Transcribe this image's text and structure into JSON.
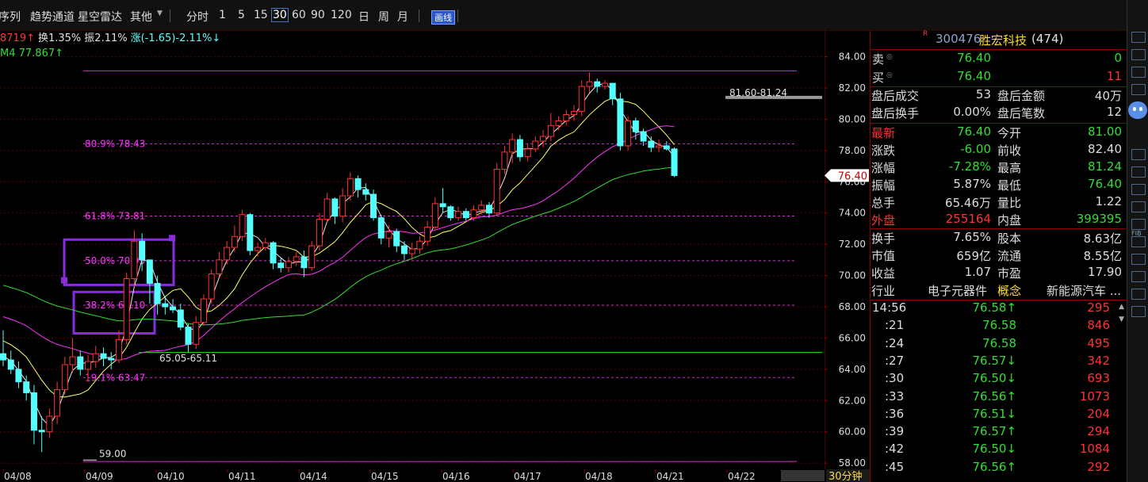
{
  "toolbar": {
    "items": [
      "序列",
      "趋势通道",
      "星空雷达",
      "其他"
    ],
    "periods": [
      "分时",
      "1",
      "5",
      "15",
      "30",
      "60",
      "90",
      "120",
      "日",
      "周",
      "月"
    ],
    "selected_period": "30",
    "draw_btn": "画线"
  },
  "info": {
    "line1_prefix": "8719↑",
    "line1_turnover": "换1.35%",
    "line1_amp": "振2.11%",
    "line1_change": "涨(-1.65)-2.11%↓",
    "line2": "M4 77.867↑"
  },
  "chart_data": {
    "type": "candlestick",
    "period": "30分钟",
    "ylim": [
      57.5,
      85.5
    ],
    "y_ticks": [
      58,
      60,
      62,
      64,
      66,
      68,
      70,
      72,
      74,
      76,
      78,
      80,
      82,
      84
    ],
    "y_tick_labels": [
      "58.00",
      "60.00",
      "62.00",
      "64.00",
      "66.00",
      "68.00",
      "70.00",
      "72.00",
      "74.00",
      "76.00",
      "78.00",
      "80.00",
      "82.00",
      "84.00"
    ],
    "x_labels": [
      "04/08",
      "04/09",
      "04/10",
      "04/11",
      "04/14",
      "04/15",
      "04/16",
      "04/17",
      "04/18",
      "04/21",
      "04/22"
    ],
    "candles_ohlc": [
      [
        65.0,
        66.5,
        64.2,
        64.6
      ],
      [
        64.6,
        65.2,
        63.7,
        64.0
      ],
      [
        64.0,
        64.5,
        62.8,
        63.2
      ],
      [
        63.2,
        63.6,
        62.0,
        62.5
      ],
      [
        62.5,
        63.0,
        59.2,
        60.1
      ],
      [
        60.1,
        61.0,
        58.7,
        60.0
      ],
      [
        60.0,
        61.5,
        59.6,
        61.0
      ],
      [
        61.0,
        63.2,
        60.5,
        62.7
      ],
      [
        62.7,
        64.8,
        62.4,
        64.3
      ],
      [
        64.3,
        66.0,
        63.8,
        64.8
      ],
      [
        64.8,
        65.2,
        63.6,
        64.0
      ],
      [
        64.0,
        64.9,
        63.2,
        64.5
      ],
      [
        64.5,
        65.5,
        64.1,
        65.0
      ],
      [
        65.0,
        65.4,
        64.2,
        64.7
      ],
      [
        64.7,
        65.1,
        64.0,
        64.6
      ],
      [
        64.6,
        66.5,
        64.4,
        65.9
      ],
      [
        65.9,
        70.2,
        65.6,
        69.8
      ],
      [
        69.8,
        72.9,
        69.3,
        72.2
      ],
      [
        72.2,
        72.7,
        70.3,
        71.0
      ],
      [
        71.0,
        70.5,
        68.2,
        69.5
      ],
      [
        69.5,
        70.0,
        67.5,
        68.2
      ],
      [
        68.2,
        68.7,
        67.5,
        68.0
      ],
      [
        68.0,
        68.5,
        67.6,
        67.8
      ],
      [
        67.8,
        68.2,
        66.5,
        66.7
      ],
      [
        66.7,
        66.9,
        65.1,
        65.6
      ],
      [
        65.6,
        67.4,
        65.3,
        67.0
      ],
      [
        67.0,
        68.8,
        66.8,
        68.5
      ],
      [
        68.5,
        70.4,
        68.2,
        70.1
      ],
      [
        70.1,
        71.5,
        69.9,
        71.0
      ],
      [
        71.0,
        72.2,
        70.7,
        71.8
      ],
      [
        71.8,
        73.2,
        71.5,
        72.5
      ],
      [
        72.5,
        74.2,
        72.2,
        73.9
      ],
      [
        73.9,
        74.0,
        71.3,
        71.6
      ],
      [
        71.6,
        72.1,
        71.2,
        71.8
      ],
      [
        71.8,
        72.4,
        71.6,
        72.1
      ],
      [
        72.1,
        72.2,
        70.4,
        70.8
      ],
      [
        70.8,
        71.1,
        70.2,
        70.5
      ],
      [
        70.5,
        71.2,
        70.2,
        70.9
      ],
      [
        70.9,
        71.5,
        70.6,
        71.2
      ],
      [
        71.2,
        71.6,
        69.9,
        70.5
      ],
      [
        70.5,
        72.2,
        70.3,
        71.9
      ],
      [
        71.9,
        74.0,
        71.6,
        73.6
      ],
      [
        73.6,
        75.3,
        73.4,
        74.9
      ],
      [
        74.9,
        75.0,
        73.3,
        73.8
      ],
      [
        73.8,
        75.6,
        73.4,
        75.1
      ],
      [
        75.1,
        76.6,
        74.8,
        76.2
      ],
      [
        76.2,
        76.4,
        75.0,
        75.5
      ],
      [
        75.5,
        75.9,
        74.8,
        75.2
      ],
      [
        75.2,
        75.5,
        73.5,
        73.7
      ],
      [
        73.7,
        73.9,
        72.0,
        72.4
      ],
      [
        72.4,
        73.2,
        71.8,
        72.8
      ],
      [
        72.8,
        73.0,
        71.5,
        71.9
      ],
      [
        71.9,
        72.2,
        71.0,
        71.4
      ],
      [
        71.4,
        72.1,
        71.0,
        71.7
      ],
      [
        71.7,
        72.5,
        71.4,
        72.2
      ],
      [
        72.2,
        73.5,
        71.9,
        73.1
      ],
      [
        73.1,
        75.0,
        72.9,
        74.6
      ],
      [
        74.6,
        75.6,
        74.0,
        74.4
      ],
      [
        74.4,
        74.5,
        73.5,
        73.7
      ],
      [
        73.7,
        74.4,
        73.5,
        74.1
      ],
      [
        74.1,
        74.3,
        73.5,
        73.7
      ],
      [
        73.7,
        74.5,
        73.5,
        74.2
      ],
      [
        74.2,
        74.8,
        73.9,
        74.5
      ],
      [
        74.5,
        74.7,
        73.7,
        74.0
      ],
      [
        74.0,
        77.2,
        73.8,
        76.8
      ],
      [
        76.8,
        78.3,
        76.5,
        77.9
      ],
      [
        77.9,
        79.1,
        77.2,
        78.7
      ],
      [
        78.7,
        79.0,
        77.3,
        77.6
      ],
      [
        77.6,
        78.4,
        77.3,
        78.1
      ],
      [
        78.1,
        78.9,
        77.9,
        78.6
      ],
      [
        78.6,
        79.3,
        78.2,
        78.9
      ],
      [
        78.9,
        80.4,
        78.6,
        79.6
      ],
      [
        79.6,
        80.2,
        79.3,
        79.9
      ],
      [
        79.9,
        80.6,
        79.6,
        80.3
      ],
      [
        80.3,
        80.9,
        79.9,
        80.5
      ],
      [
        80.5,
        82.5,
        80.2,
        82.1
      ],
      [
        82.1,
        83.0,
        81.7,
        82.4
      ],
      [
        82.4,
        82.6,
        81.7,
        82.1
      ],
      [
        82.1,
        82.5,
        81.9,
        82.3
      ],
      [
        82.3,
        81.6,
        80.9,
        81.3
      ],
      [
        81.3,
        81.7,
        78.0,
        78.3
      ],
      [
        78.3,
        80.2,
        78.0,
        79.9
      ],
      [
        79.9,
        80.1,
        78.7,
        79.2
      ],
      [
        79.2,
        79.4,
        78.3,
        78.6
      ],
      [
        78.6,
        78.9,
        77.9,
        78.2
      ],
      [
        78.2,
        78.7,
        77.9,
        78.3
      ],
      [
        78.3,
        78.6,
        78.0,
        78.1
      ],
      [
        78.1,
        78.2,
        76.3,
        76.4
      ]
    ],
    "series": [
      {
        "name": "M1",
        "color": "#e8e8e8"
      },
      {
        "name": "M2",
        "color": "#ffff66"
      },
      {
        "name": "M3",
        "color": "#ff33ff"
      },
      {
        "name": "M4",
        "color": "#33dd33"
      }
    ],
    "fib_labels": [
      {
        "text": "80.9% 78.43",
        "price": 78.43
      },
      {
        "text": "61.8% 73.81",
        "price": 73.81
      },
      {
        "text": "50.0% 70.95",
        "price": 70.95
      },
      {
        "text": "38.2% 68.10",
        "price": 68.1
      },
      {
        "text": "19.1% 63.47",
        "price": 63.47
      }
    ],
    "range_labels": [
      {
        "text": "81.60-81.24",
        "price": 81.5
      },
      {
        "text": "65.05-65.11",
        "price": 65.1
      },
      {
        "text": "59.00",
        "price": 59.0
      }
    ],
    "current_price_label": "76.40",
    "period_label": "30分钟"
  },
  "panel": {
    "stock_code": "300476",
    "stock_name": "胜宏科技",
    "stock_rank": "(474)",
    "r_mark": "R",
    "sell_label": "卖",
    "sell_price": "76.40",
    "sell_vol": "0",
    "buy_label": "买",
    "buy_price": "76.40",
    "buy_vol": "11",
    "stats": [
      {
        "l1": "盘后成交",
        "v1": "53",
        "l2": "盘后金额",
        "v2": "40万"
      },
      {
        "l1": "盘后换手",
        "v1": "0.00%",
        "l2": "盘后笔数",
        "v2": "12"
      },
      {
        "l1": "最新",
        "v1": "76.40",
        "l2": "今开",
        "v2": "81.00"
      },
      {
        "l1": "涨跌",
        "v1": "-6.00",
        "l2": "前收",
        "v2": "82.40"
      },
      {
        "l1": "涨幅",
        "v1": "-7.28%",
        "l2": "最高",
        "v2": "81.24"
      },
      {
        "l1": "振幅",
        "v1": "5.87%",
        "l2": "最低",
        "v2": "76.40"
      },
      {
        "l1": "总手",
        "v1": "65.46万",
        "l2": "量比",
        "v2": "1.22"
      },
      {
        "l1": "外盘",
        "v1": "255164",
        "l2": "内盘",
        "v2": "399395"
      },
      {
        "l1": "换手",
        "v1": "7.65%",
        "l2": "股本",
        "v2": "8.63亿"
      },
      {
        "l1": "市值",
        "v1": "659亿",
        "l2": "流通",
        "v2": "8.55亿"
      },
      {
        "l1": "收益",
        "v1": "1.07",
        "l2": "市盈",
        "v2": "17.90"
      }
    ],
    "industry_label": "行业",
    "industry_value": "电子元器件",
    "concept_label": "概念",
    "concept_value": "新能源汽车 ...",
    "ticks": [
      {
        "time": "14:56",
        "price": "76.58↑",
        "vol": "295"
      },
      {
        "time": ":21",
        "price": "76.58",
        "vol": "846"
      },
      {
        "time": ":24",
        "price": "76.58",
        "vol": "495"
      },
      {
        "time": ":27",
        "price": "76.57↓",
        "vol": "342"
      },
      {
        "time": ":30",
        "price": "76.50↓",
        "vol": "693"
      },
      {
        "time": ":33",
        "price": "76.56↑",
        "vol": "1073"
      },
      {
        "time": ":36",
        "price": "76.51↓",
        "vol": "204"
      },
      {
        "time": ":39",
        "price": "76.57↑",
        "vol": "294"
      },
      {
        "time": ":42",
        "price": "76.50↓",
        "vol": "1084"
      },
      {
        "time": ":45",
        "price": "76.56↑",
        "vol": "292"
      }
    ]
  },
  "side_icons": [
    "robot-icon",
    "fib-icon",
    "fib-arc-icon",
    "fib-fan-icon",
    "fib-time-icon"
  ],
  "colors": {
    "up": "#ff3333",
    "down": "#54ffff",
    "grid": "#8b0000",
    "fib": "#ff33ff",
    "text_green": "#33dd33",
    "accent": "#8a2be2"
  }
}
